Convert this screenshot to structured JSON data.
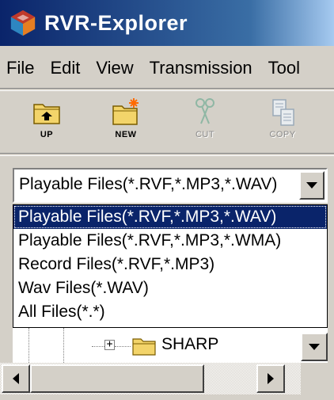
{
  "window": {
    "title": "RVR-Explorer",
    "app_icon": "rvr-app-icon"
  },
  "menubar": {
    "items": [
      {
        "label": "File"
      },
      {
        "label": "Edit"
      },
      {
        "label": "View"
      },
      {
        "label": "Transmission"
      },
      {
        "label": "Tool"
      }
    ]
  },
  "toolbar": {
    "buttons": [
      {
        "label": "UP",
        "icon": "folder-up-icon",
        "enabled": true
      },
      {
        "label": "NEW",
        "icon": "new-folder-icon",
        "enabled": true
      },
      {
        "label": "CUT",
        "icon": "scissors-icon",
        "enabled": false
      },
      {
        "label": "COPY",
        "icon": "copy-icon",
        "enabled": false
      }
    ]
  },
  "file_type_combo": {
    "selected": "Playable Files(*.RVF,*.MP3,*.WAV)",
    "options": [
      "Playable Files(*.RVF,*.MP3,*.WAV)",
      "Playable Files(*.RVF,*.MP3,*.WMA)",
      "Record Files(*.RVF,*.MP3)",
      "Wav Files(*.WAV)",
      "All Files(*.*)"
    ],
    "highlighted_index": 0
  },
  "tree": {
    "visible_node": {
      "label": "SHARP",
      "expander": "+",
      "icon": "folder-icon"
    }
  },
  "colors": {
    "title_bar": "#0a246a",
    "selection": "#0a246a",
    "chrome": "#d4d0c8"
  }
}
